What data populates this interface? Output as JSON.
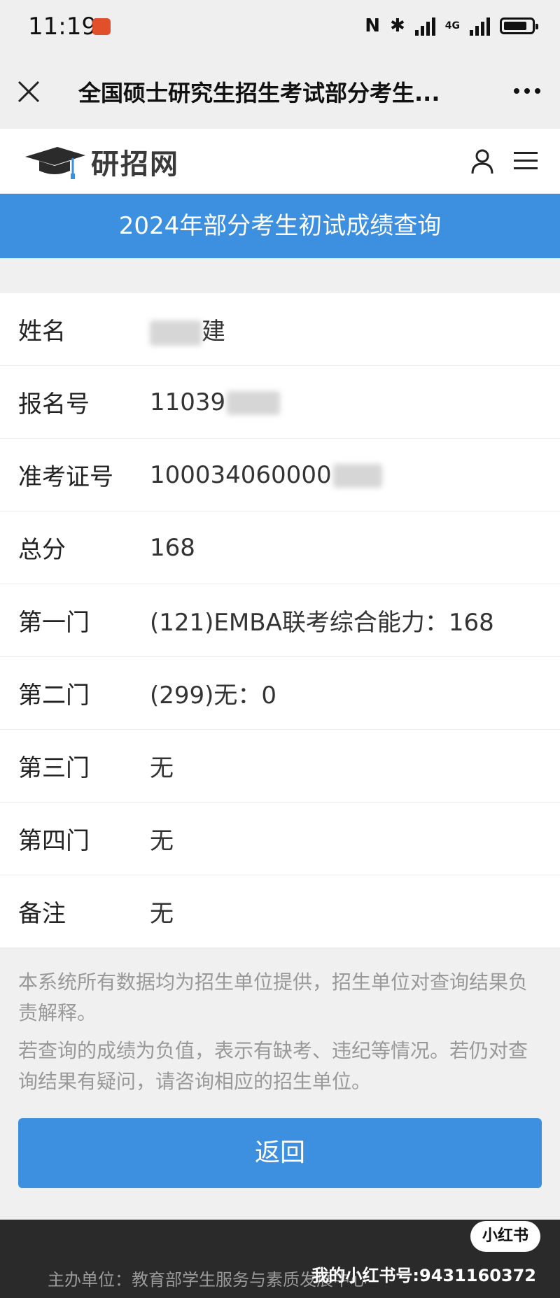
{
  "status_bar": {
    "time": "11:19",
    "battery_level": 0.85,
    "nfc_glyph": "N",
    "bluetooth_glyph": "✱",
    "network_label": "4G"
  },
  "navbar": {
    "title": "全国硕士研究生招生考试部分考生..."
  },
  "site": {
    "logo_text": "研招网"
  },
  "banner": {
    "title": "2024年部分考生初试成绩查询"
  },
  "rows": [
    {
      "label": "姓名",
      "value": "建"
    },
    {
      "label": "报名号",
      "value": "11039"
    },
    {
      "label": "准考证号",
      "value": "100034060000"
    },
    {
      "label": "总分",
      "value": "168"
    },
    {
      "label": "第一门",
      "value": "(121)EMBA联考综合能力：168"
    },
    {
      "label": "第二门",
      "value": "(299)无：0"
    },
    {
      "label": "第三门",
      "value": "无"
    },
    {
      "label": "第四门",
      "value": "无"
    },
    {
      "label": "备注",
      "value": "无"
    }
  ],
  "notes": [
    "本系统所有数据均为招生单位提供，招生单位对查询结果负责解释。",
    "若查询的成绩为负值，表示有缺考、违纪等情况。若仍对查询结果有疑问，请咨询相应的招生单位。"
  ],
  "back_button_label": "返回",
  "footer": {
    "text": "主办单位：教育部学生服务与素质发展中心",
    "watermark_badge": "小红书",
    "watermark_id": "我的小红书号:9431160372"
  },
  "colors": {
    "accent": "#3d8fe0",
    "footer_bg": "#2a2a2a"
  }
}
